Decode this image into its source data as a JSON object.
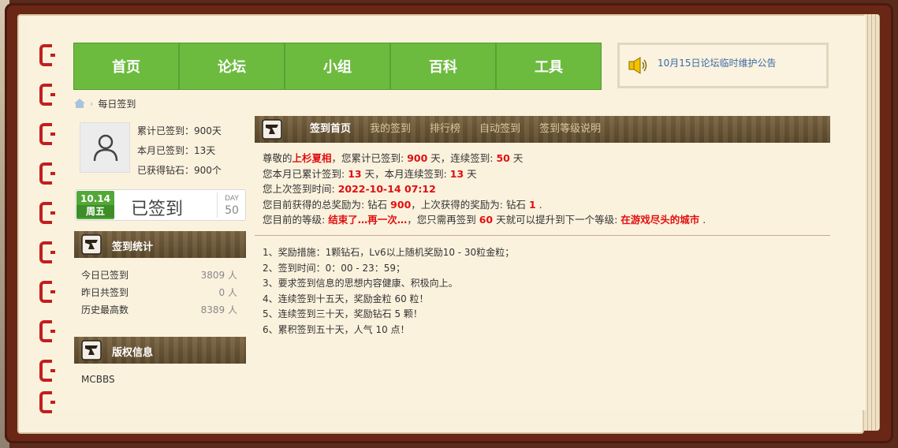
{
  "nav": {
    "items": [
      "首页",
      "论坛",
      "小组",
      "百科",
      "工具"
    ]
  },
  "notice": {
    "text": "10月15日论坛临时维护公告",
    "icon": "speaker-icon"
  },
  "breadcrumb": {
    "home_icon": "home-icon",
    "current": "每日签到"
  },
  "user": {
    "total_signed": "累计已签到：900天",
    "month_signed": "本月已签到：13天",
    "diamonds": "已获得钻石：900个"
  },
  "sign_box": {
    "date": "10.14",
    "weekday": "周五",
    "status": "已签到",
    "day_label": "DAY",
    "day_value": "50"
  },
  "stats_panel": {
    "title": "签到统计",
    "rows": [
      {
        "label": "今日已签到",
        "value": "3809 人"
      },
      {
        "label": "昨日共签到",
        "value": "0 人"
      },
      {
        "label": "历史最高数",
        "value": "8389 人"
      }
    ]
  },
  "copyright_panel": {
    "title": "版权信息",
    "text": "MCBBS"
  },
  "main_tabs": [
    "签到首页",
    "我的签到",
    "排行榜",
    "自动签到",
    "签到等级说明"
  ],
  "summary": {
    "l1_a": "尊敬的",
    "l1_name": "上杉夏相",
    "l1_b": "，您累计已签到: ",
    "l1_total": "900",
    "l1_c": " 天，连续签到: ",
    "l1_streak": "50",
    "l1_d": " 天",
    "l2_a": "您本月已累计签到: ",
    "l2_month": "13",
    "l2_b": " 天，本月连续签到: ",
    "l2_month_streak": "13",
    "l2_c": " 天",
    "l3_a": "您上次签到时间: ",
    "l3_time": "2022-10-14 07:12",
    "l4_a": "您目前获得的总奖励为: 钻石 ",
    "l4_total": "900",
    "l4_b": "，上次获得的奖励为: 钻石 ",
    "l4_last": "1",
    "l4_c": " .",
    "l5_a": "您目前的等级: ",
    "l5_level": "结束了…再一次…",
    "l5_b": "，您只需再签到 ",
    "l5_days": "60",
    "l5_c": " 天就可以提升到下一个等级: ",
    "l5_next": "在游戏尽头的城市",
    "l5_d": " ."
  },
  "rules": [
    "1、奖励措施：1颗钻石，Lv6以上随机奖励10 - 30粒金粒；",
    "2、签到时间：0：00 - 23：59；",
    "3、要求签到信息的思想内容健康、积极向上。",
    "4、连续签到十五天，奖励金粒 60 粒！",
    "5、连续签到三十天，奖励钻石 5 颗！",
    "6、累积签到五十天，人气 10 点！"
  ],
  "colors": {
    "nav_green": "#6cbb3f",
    "accent_red": "#e01010",
    "frame_brown": "#6b2716",
    "binding_red": "#c11f1f"
  }
}
